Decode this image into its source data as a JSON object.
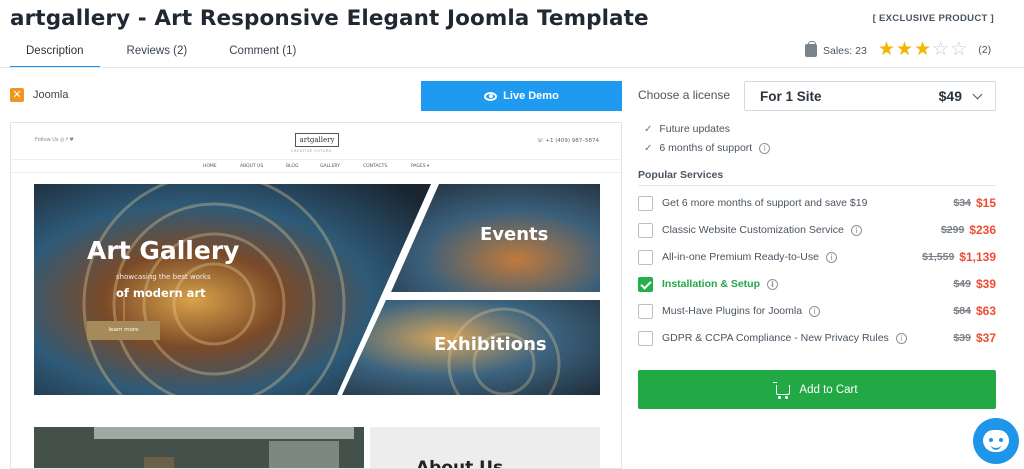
{
  "product": {
    "title": "artgallery - Art Responsive Elegant Joomla Template",
    "badge": "[ EXCLUSIVE PRODUCT ]"
  },
  "tabs": [
    {
      "label": "Description",
      "active": true
    },
    {
      "label": "Reviews (2)",
      "active": false
    },
    {
      "label": "Comment (1)",
      "active": false
    }
  ],
  "stats": {
    "sales": "Sales: 23",
    "rating": 3,
    "rating_max": 5,
    "rating_count": "(2)"
  },
  "platform": "Joomla",
  "live_demo": "Live Demo",
  "preview": {
    "follow": "Follow Us  ◎ f ♥",
    "logo": "artgallery",
    "logo_sub": "CREATIVE FUTURE",
    "phone": "☏ +1 (409) 987–5874",
    "menu": [
      "HOME",
      "ABOUT US",
      "BLOG",
      "GALLERY",
      "CONTACTS",
      "PAGES ▾"
    ],
    "hero_title": "Art Gallery",
    "hero_sub1": "showcasing the best works",
    "hero_sub2": "of modern art",
    "hero_btn": "learn more",
    "events": "Events",
    "exhibitions": "Exhibitions",
    "about": "About Us"
  },
  "license": {
    "label": "Choose a license",
    "selected": "For 1 Site",
    "price": "$49"
  },
  "features": [
    {
      "text": "Future updates",
      "info": false
    },
    {
      "text": "6 months of support",
      "info": true
    }
  ],
  "services_heading": "Popular Services",
  "services": [
    {
      "label": "Get 6 more months of support and save $19",
      "info": false,
      "checked": false,
      "old": "$34",
      "new": "$15"
    },
    {
      "label": "Classic Website Customization Service",
      "info": true,
      "checked": false,
      "old": "$299",
      "new": "$236"
    },
    {
      "label": "All-in-one Premium Ready-to-Use",
      "info": true,
      "checked": false,
      "old": "$1,559",
      "new": "$1,139"
    },
    {
      "label": "Installation & Setup",
      "info": true,
      "checked": true,
      "old": "$49",
      "new": "$39"
    },
    {
      "label": "Must-Have Plugins for Joomla",
      "info": true,
      "checked": false,
      "old": "$84",
      "new": "$63"
    },
    {
      "label": "GDPR & CCPA Compliance - New Privacy Rules",
      "info": true,
      "checked": false,
      "old": "$39",
      "new": "$37"
    }
  ],
  "add_to_cart": "Add to Cart",
  "colors": {
    "accent_blue": "#1e9bf0",
    "cart_green": "#22a845",
    "sale_red": "#ef4c34",
    "star_gold": "#f5b400"
  }
}
